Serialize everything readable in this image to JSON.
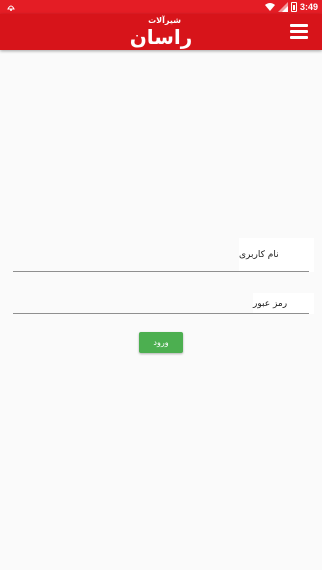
{
  "status_bar": {
    "time": "3:49",
    "icons": [
      "notification-icon",
      "wifi-icon",
      "signal-icon",
      "battery-icon"
    ]
  },
  "toolbar": {
    "logo_small": "شیرآلات",
    "logo_main": "راسان",
    "menu_icon": "hamburger-menu-icon",
    "color": "#d7141a"
  },
  "form": {
    "username_label": "نام کاربری",
    "username_value": "",
    "password_label": "رمز عبور",
    "password_value": "",
    "login_label": "ورود",
    "login_color": "#4caf50"
  }
}
